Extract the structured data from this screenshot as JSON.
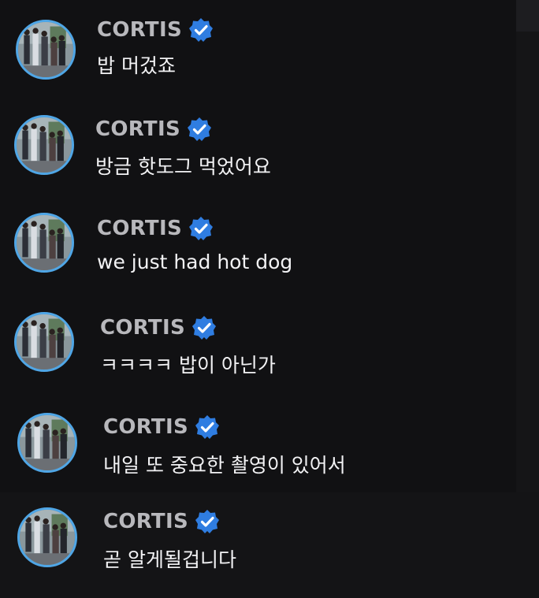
{
  "chat": {
    "accent_color": "#4fa6e6",
    "verified_color": "#2f7de1",
    "messages": [
      {
        "sender": "CORTIS",
        "verified": true,
        "text": "밥 머겄죠"
      },
      {
        "sender": "CORTIS",
        "verified": true,
        "text": "방금 핫도그 먹었어요"
      },
      {
        "sender": "CORTIS",
        "verified": true,
        "text": "we just had hot dog"
      },
      {
        "sender": "CORTIS",
        "verified": true,
        "text": "ㅋㅋㅋㅋ 밥이 아닌가"
      },
      {
        "sender": "CORTIS",
        "verified": true,
        "text": "내일 또 중요한 촬영이 있어서"
      },
      {
        "sender": "CORTIS",
        "verified": true,
        "text": "곧 알게될겁니다"
      }
    ]
  }
}
